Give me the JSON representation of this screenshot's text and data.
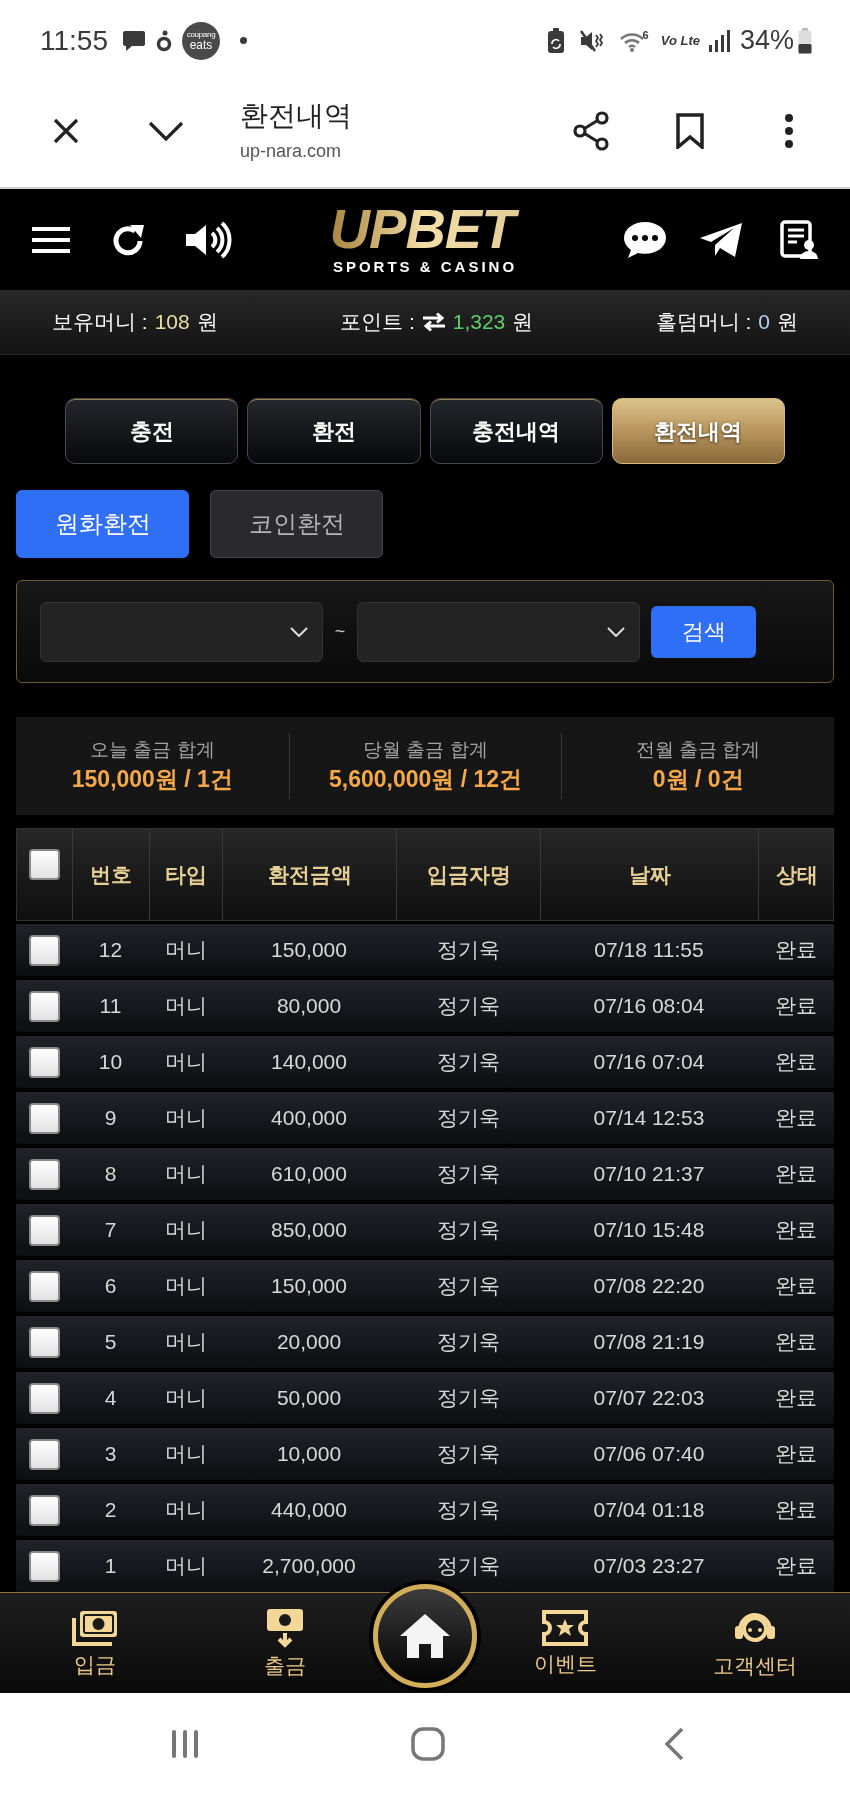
{
  "status_bar": {
    "time": "11:55",
    "app_logo": {
      "line_1": "coupang",
      "line_2": "eats"
    },
    "wifi_label": "6",
    "network_label": "Vo Lte",
    "battery": "34%"
  },
  "browser_bar": {
    "title": "환전내역",
    "url": "up-nara.com"
  },
  "header": {
    "logo": {
      "wordmark": "UPBET",
      "tagline": "SPORTS & CASINO"
    }
  },
  "balances": [
    {
      "kind": "plain",
      "label": "보유머니 :",
      "value": "108",
      "unit": "원",
      "color": "#eadca6"
    },
    {
      "kind": "exchange",
      "label": "포인트 :",
      "value": "1,323",
      "unit": "원",
      "color": "#5fd068"
    },
    {
      "kind": "plain",
      "label": "홀덤머니 :",
      "value": "0",
      "unit": "원",
      "color": "#b4cdf0"
    }
  ],
  "tabs": [
    {
      "label": "충전",
      "selected": false
    },
    {
      "label": "환전",
      "selected": false
    },
    {
      "label": "충전내역",
      "selected": false
    },
    {
      "label": "환전내역",
      "selected": true
    }
  ],
  "sub_tabs": [
    {
      "label": "원화환전",
      "selected": true
    },
    {
      "label": "코인환전",
      "selected": false
    }
  ],
  "filter": {
    "separator": "~",
    "search_button": "검색"
  },
  "summary": [
    {
      "label": "오늘 출금 합계",
      "value": "150,000원 / 1건"
    },
    {
      "label": "당월 출금 합계",
      "value": "5,600,000원 / 12건"
    },
    {
      "label": "전월 출금 합계",
      "value": "0원 / 0건"
    }
  ],
  "table": {
    "select_all": {
      "checked": false
    },
    "columns": [
      "번호",
      "타입",
      "환전금액",
      "입금자명",
      "날짜",
      "상태"
    ],
    "rows": [
      {
        "checked": false,
        "cells": [
          "12",
          "머니",
          "150,000",
          "정기욱",
          "07/18 11:55",
          "완료"
        ]
      },
      {
        "checked": false,
        "cells": [
          "11",
          "머니",
          "80,000",
          "정기욱",
          "07/16 08:04",
          "완료"
        ]
      },
      {
        "checked": false,
        "cells": [
          "10",
          "머니",
          "140,000",
          "정기욱",
          "07/16 07:04",
          "완료"
        ]
      },
      {
        "checked": false,
        "cells": [
          "9",
          "머니",
          "400,000",
          "정기욱",
          "07/14 12:53",
          "완료"
        ]
      },
      {
        "checked": false,
        "cells": [
          "8",
          "머니",
          "610,000",
          "정기욱",
          "07/10 21:37",
          "완료"
        ]
      },
      {
        "checked": false,
        "cells": [
          "7",
          "머니",
          "850,000",
          "정기욱",
          "07/10 15:48",
          "완료"
        ]
      },
      {
        "checked": false,
        "cells": [
          "6",
          "머니",
          "150,000",
          "정기욱",
          "07/08 22:20",
          "완료"
        ]
      },
      {
        "checked": false,
        "cells": [
          "5",
          "머니",
          "20,000",
          "정기욱",
          "07/08 21:19",
          "완료"
        ]
      },
      {
        "checked": false,
        "cells": [
          "4",
          "머니",
          "50,000",
          "정기욱",
          "07/07 22:03",
          "완료"
        ]
      },
      {
        "checked": false,
        "cells": [
          "3",
          "머니",
          "10,000",
          "정기욱",
          "07/06 07:40",
          "완료"
        ]
      },
      {
        "checked": false,
        "cells": [
          "2",
          "머니",
          "440,000",
          "정기욱",
          "07/04 01:18",
          "완료"
        ]
      },
      {
        "checked": false,
        "cells": [
          "1",
          "머니",
          "2,700,000",
          "정기욱",
          "07/03 23:27",
          "완료"
        ]
      }
    ]
  },
  "bottom_nav": [
    {
      "label": "입금"
    },
    {
      "label": "출금"
    },
    {
      "label": "이벤트"
    },
    {
      "label": "고객센터"
    }
  ]
}
